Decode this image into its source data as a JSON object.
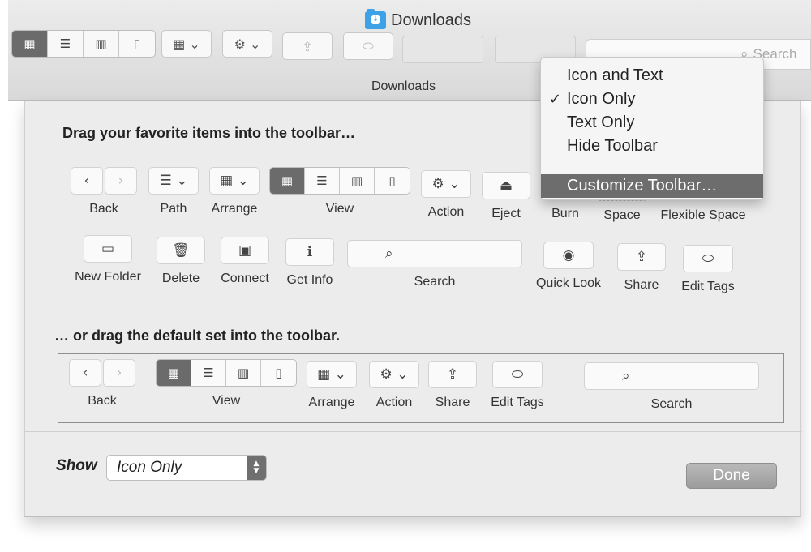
{
  "window": {
    "title": "Downloads",
    "tab_title": "Downloads",
    "search_placeholder": "Search"
  },
  "menu": {
    "items": [
      {
        "label": "Icon and Text",
        "checked": false
      },
      {
        "label": "Icon Only",
        "checked": true
      },
      {
        "label": "Text Only",
        "checked": false
      },
      {
        "label": "Hide Toolbar",
        "checked": false
      }
    ],
    "customize_label": "Customize Toolbar…",
    "checkmark": "✓"
  },
  "sheet": {
    "heading_items": "Drag your favorite items into the toolbar…",
    "heading_default": "… or drag the default set into the toolbar.",
    "items": {
      "back": "Back",
      "path": "Path",
      "arrange": "Arrange",
      "view": "View",
      "action": "Action",
      "eject": "Eject",
      "burn": "Burn",
      "space": "Space",
      "flexible_space": "Flexible Space",
      "new_folder": "New Folder",
      "delete": "Delete",
      "connect": "Connect",
      "get_info": "Get Info",
      "search": "Search",
      "quick_look": "Quick Look",
      "share": "Share",
      "edit_tags": "Edit Tags"
    },
    "default_set": {
      "back": "Back",
      "view": "View",
      "arrange": "Arrange",
      "action": "Action",
      "share": "Share",
      "edit_tags": "Edit Tags",
      "search": "Search"
    },
    "show_label": "Show",
    "show_value": "Icon Only",
    "done_label": "Done"
  },
  "icons": {
    "back": "‹",
    "forward": "›",
    "icon_view": "▦",
    "list_view": "☰",
    "column_view": "▥",
    "coverflow_view": "▯",
    "arrange": "▦",
    "gear": "⚙",
    "chevron": "⌄",
    "eject": "⏏",
    "share": "⇪",
    "tag": "⬭",
    "folder_plus": "▭",
    "trash": "🗑",
    "connect": "▣",
    "info": "ℹ",
    "search": "⌕",
    "eye": "◉"
  },
  "colors": {
    "selected_segment": "#6b6b6b",
    "menu_highlight": "#6d6d6d",
    "folder_blue": "#3da3e6"
  }
}
